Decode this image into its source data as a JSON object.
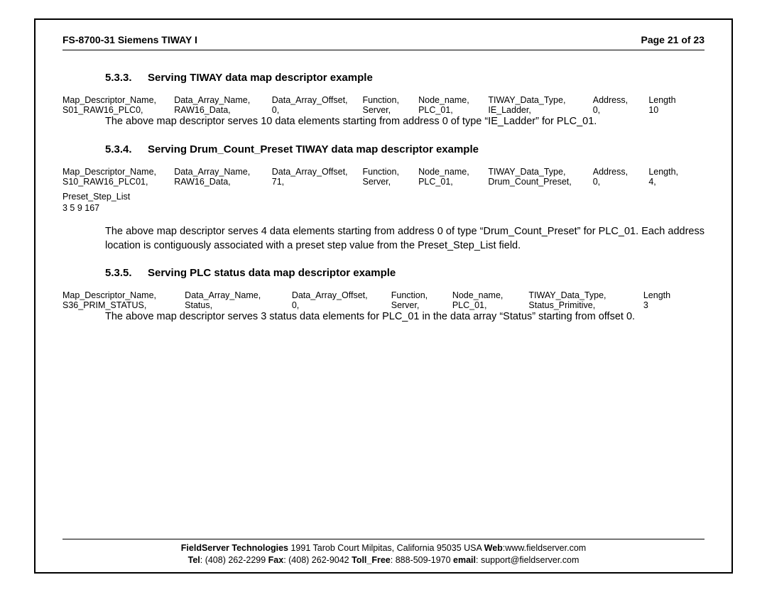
{
  "header": {
    "left": "FS-8700-31 Siemens TIWAY I",
    "right": "Page 21 of 23"
  },
  "s533": {
    "num": "5.3.3.",
    "title": "Serving TIWAY data map descriptor example",
    "table": {
      "h": [
        "Map_Descriptor_Name,",
        "Data_Array_Name,",
        "Data_Array_Offset,",
        "Function,",
        "Node_name,",
        "TIWAY_Data_Type,",
        "Address,",
        "Length"
      ],
      "r": [
        "S01_RAW16_PLC0,",
        "RAW16_Data,",
        "0,",
        "Server,",
        "PLC_01,",
        "IE_Ladder,",
        "0,",
        "10"
      ]
    },
    "body": "The above map descriptor serves 10 data elements starting from address 0 of type “IE_Ladder” for PLC_01."
  },
  "s534": {
    "num": "5.3.4.",
    "title": "Serving Drum_Count_Preset TIWAY data map descriptor example",
    "table": {
      "h": [
        "Map_Descriptor_Name,",
        "Data_Array_Name,",
        "Data_Array_Offset,",
        "Function,",
        "Node_name,",
        "TIWAY_Data_Type,",
        "Address,",
        "Length,"
      ],
      "r": [
        "S10_RAW16_PLC01,",
        "RAW16_Data,",
        "71,",
        "Server,",
        "PLC_01,",
        "Drum_Count_Preset,",
        "0,",
        "4,"
      ]
    },
    "preset_label": "Preset_Step_List",
    "preset_values": "3 5 9 167",
    "body": "The above map descriptor serves 4 data elements starting from address 0 of type “Drum_Count_Preset” for PLC_01. Each address location is contiguously associated with a preset step value from the Preset_Step_List field."
  },
  "s535": {
    "num": "5.3.5.",
    "title": "Serving PLC status data map descriptor example",
    "table": {
      "h": [
        "Map_Descriptor_Name,",
        "Data_Array_Name,",
        "Data_Array_Offset,",
        "Function,",
        "Node_name,",
        "TIWAY_Data_Type,",
        "Length"
      ],
      "r": [
        "S36_PRIM_STATUS,",
        "Status,",
        "0,",
        "Server,",
        "PLC_01,",
        "Status_Primitive,",
        "3"
      ]
    },
    "body": "The above map descriptor serves 3 status data elements for PLC_01 in the data array “Status” starting from offset 0."
  },
  "footer": {
    "line1": {
      "company": "FieldServer Technologies",
      "address": " 1991 Tarob Court Milpitas, California 95035 USA  ",
      "web_label": "Web",
      "web_value": ":www.fieldserver.com"
    },
    "line2": {
      "tel_label": "Tel",
      "tel_value": ": (408) 262-2299   ",
      "fax_label": "Fax",
      "fax_value": ": (408) 262-9042   ",
      "toll_label": "Toll_Free",
      "toll_value": ": 888-509-1970   ",
      "email_label": "email",
      "email_value": ": support@fieldserver.com"
    }
  },
  "colwidths8": [
    "16%",
    "14%",
    "13%",
    "8%",
    "10%",
    "15%",
    "8%",
    "8%"
  ],
  "colwidths7": [
    "16%",
    "14%",
    "13%",
    "8%",
    "10%",
    "15%",
    "8%"
  ]
}
